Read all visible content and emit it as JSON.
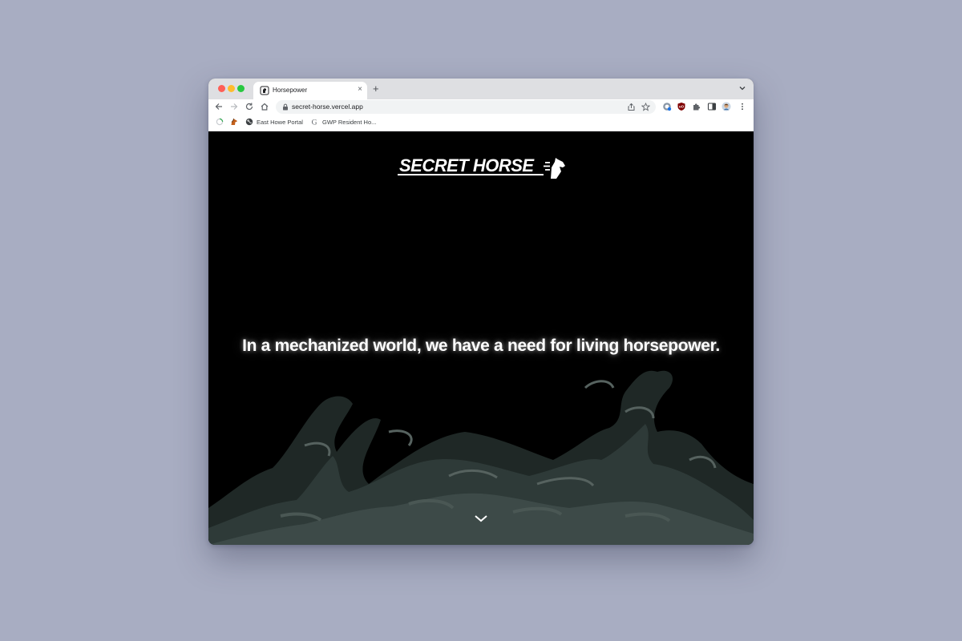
{
  "browser": {
    "tab": {
      "title": "Horsepower",
      "close_glyph": "×"
    },
    "new_tab_glyph": "+",
    "url": "secret-horse.vercel.app",
    "bookmarks": [
      {
        "label": "",
        "icon": "loading-spinner-icon"
      },
      {
        "label": "",
        "icon": "horse-favicon-icon"
      },
      {
        "label": "East Howe Portal",
        "icon": "globe-icon"
      },
      {
        "label": "GWP Resident Ho...",
        "icon": "google-g-icon"
      }
    ],
    "window_colors": {
      "close": "#fe5f57",
      "minimize": "#febc2e",
      "zoom": "#28c840"
    }
  },
  "page": {
    "logo_text": "SECRET HORSE",
    "headline": "In a mechanized world, we have a need for living horsepower.",
    "scroll_icon": "chevron-down-icon",
    "background": "#000000",
    "cloud_color": "#3d4a48"
  }
}
